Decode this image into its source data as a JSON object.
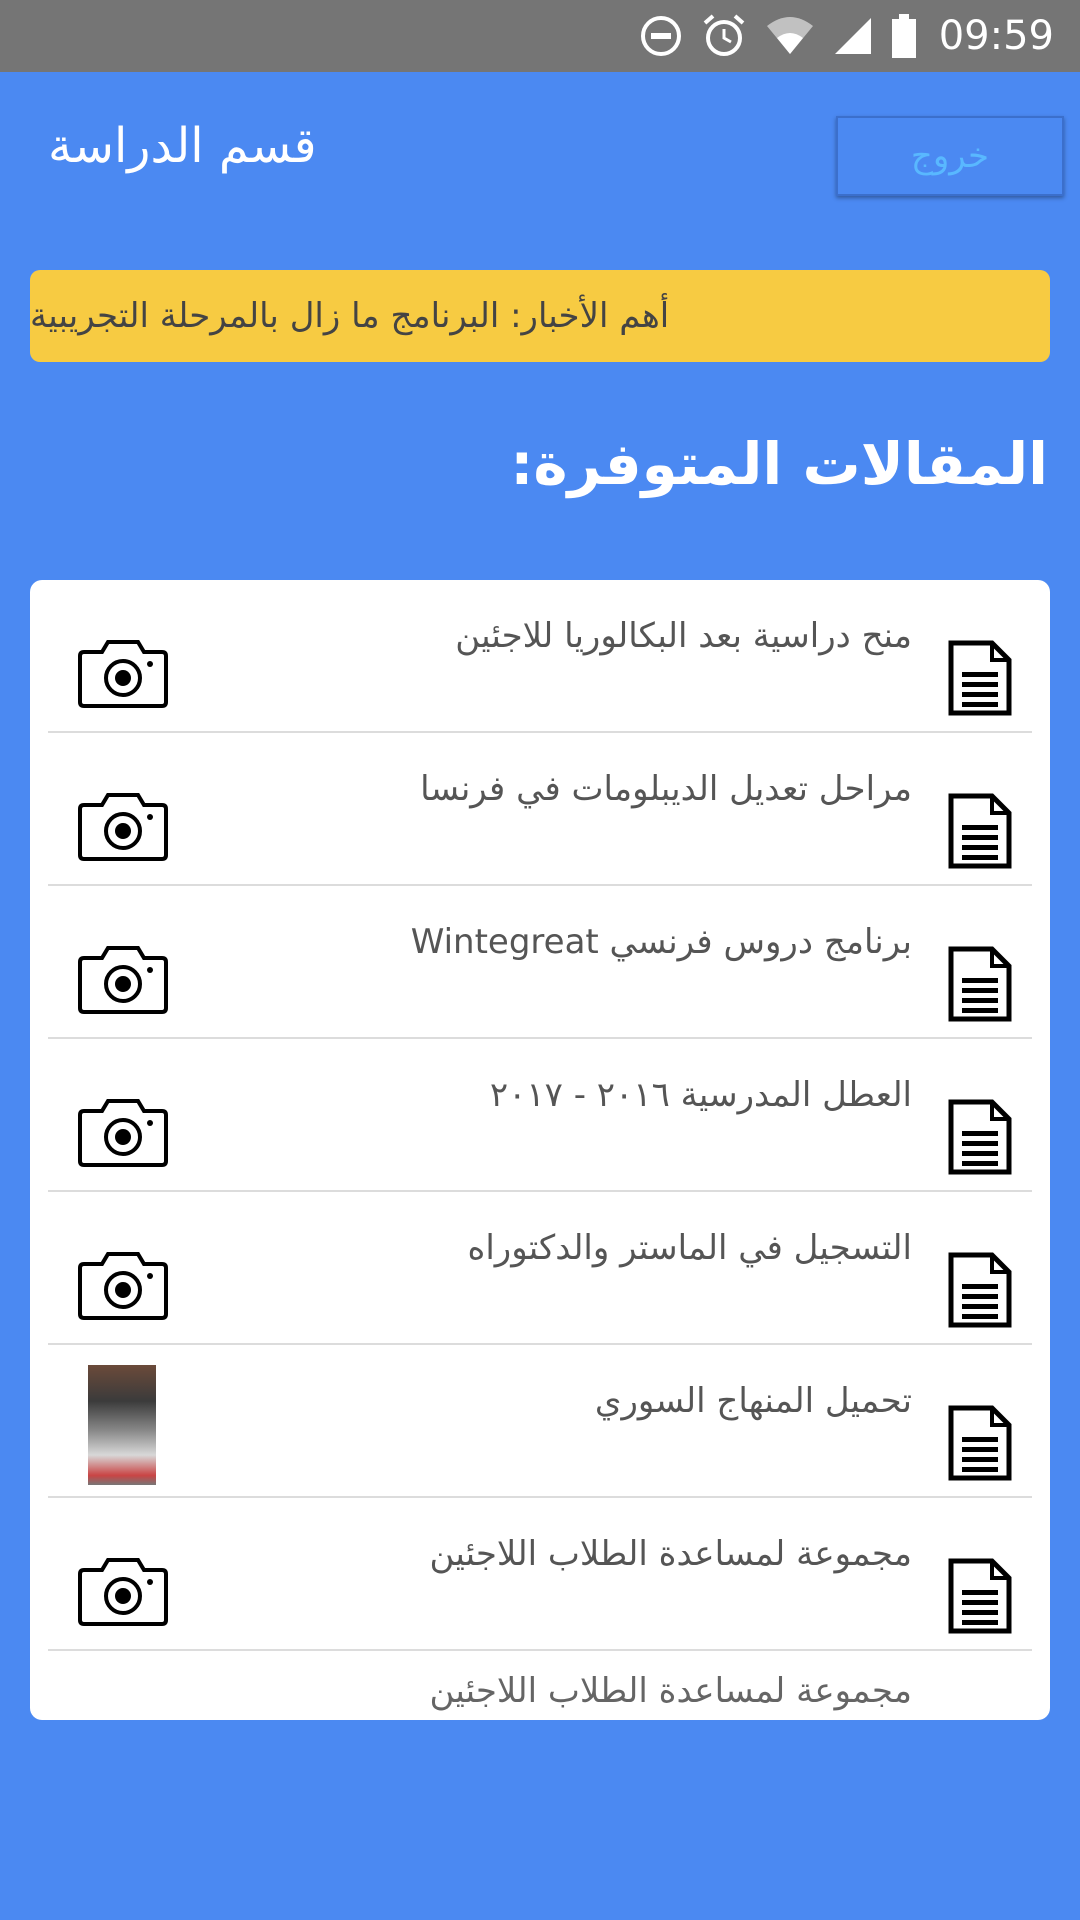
{
  "status_bar": {
    "time": "09:59",
    "icons": [
      "do-not-disturb-icon",
      "alarm-icon",
      "wifi-icon",
      "signal-icon",
      "battery-icon"
    ]
  },
  "header": {
    "title": "قسم الدراسة",
    "logout_label": "خروج"
  },
  "news": {
    "text": "أهم الأخبار: البرنامج ما زال بالمرحلة التجريبية"
  },
  "section_title": "المقالات المتوفرة:",
  "articles": [
    {
      "title": "منح دراسية بعد البكالوريا للاجئين",
      "image": "camera-placeholder"
    },
    {
      "title": "مراحل تعديل الديبلومات في فرنسا",
      "image": "camera-placeholder"
    },
    {
      "title": "برنامج دروس فرنسي Wintegreat",
      "image": "camera-placeholder"
    },
    {
      "title": "العطل المدرسية ٢٠١٦ - ٢٠١٧",
      "image": "camera-placeholder"
    },
    {
      "title": "التسجيل في الماستر والدكتوراه",
      "image": "camera-placeholder"
    },
    {
      "title": "تحميل المنهاج السوري",
      "image": "photo-thumbnail"
    },
    {
      "title": "مجموعة لمساعدة الطلاب اللاجئين",
      "image": "camera-placeholder"
    },
    {
      "title": "مجموعة لمساعدة الطلاب اللاجئين",
      "image": "camera-placeholder"
    }
  ],
  "colors": {
    "background": "#4b89f2",
    "status_bar": "#757575",
    "news_banner": "#f7cb42",
    "logout_text": "#59b8ff"
  }
}
